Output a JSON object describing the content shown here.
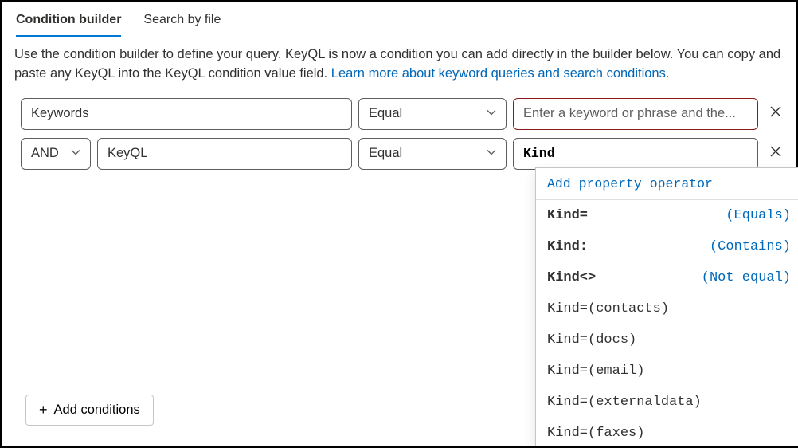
{
  "tabs": {
    "builder": "Condition builder",
    "file": "Search by file"
  },
  "description": {
    "text": "Use the condition builder to define your query. KeyQL is now a condition you can add directly in the builder below. You can copy and paste any KeyQL into the KeyQL condition value field. ",
    "link": "Learn more about keyword queries and search conditions."
  },
  "row1": {
    "property": "Keywords",
    "operator": "Equal",
    "placeholder": "Enter a keyword or phrase and the..."
  },
  "row2": {
    "logical": "AND",
    "property": "KeyQL",
    "operator": "Equal",
    "value": "Kind"
  },
  "suggestions": {
    "header": "Add property operator",
    "ops": [
      {
        "label": "Kind=",
        "hint": "(Equals)"
      },
      {
        "label": "Kind:",
        "hint": "(Contains)"
      },
      {
        "label": "Kind<>",
        "hint": "(Not equal)"
      }
    ],
    "values": [
      "Kind=(contacts)",
      "Kind=(docs)",
      "Kind=(email)",
      "Kind=(externaldata)",
      "Kind=(faxes)"
    ]
  },
  "add_button": {
    "label": "Add conditions"
  }
}
